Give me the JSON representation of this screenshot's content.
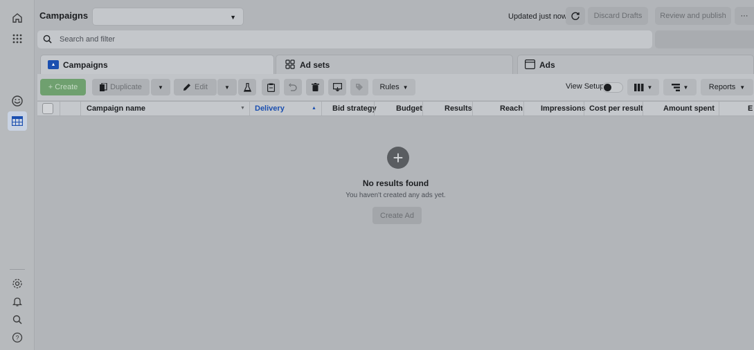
{
  "app": {
    "title": "Campaigns",
    "campaign_select_value": "",
    "updated_text": "Updated just now",
    "discard_label": "Discard Drafts",
    "review_label": "Review and publish",
    "more_label": "···"
  },
  "search": {
    "placeholder": "Search and filter"
  },
  "tabs": [
    {
      "label": "Campaigns",
      "icon": "folder-icon",
      "active": true
    },
    {
      "label": "Ad sets",
      "icon": "grid-icon",
      "active": false
    },
    {
      "label": "Ads",
      "icon": "ad-card-icon",
      "active": false
    }
  ],
  "toolbar": {
    "create_label": "+ Create",
    "duplicate_label": "Duplicate",
    "edit_label": "Edit",
    "rules_label": "Rules",
    "view_setup_label": "View Setup",
    "reports_label": "Reports"
  },
  "table": {
    "columns": [
      "Campaign name",
      "Delivery",
      "Bid strategy",
      "Budget",
      "Results",
      "Reach",
      "Impressions",
      "Cost per result",
      "Amount spent",
      "E"
    ]
  },
  "empty_state": {
    "title": "No results found",
    "subtitle": "You haven't created any ads yet.",
    "button_label": "Create Ad"
  },
  "colors": {
    "overlay": "#b2b5b9",
    "accent": "#1b4fb0",
    "create_green": "#6fa06f"
  }
}
